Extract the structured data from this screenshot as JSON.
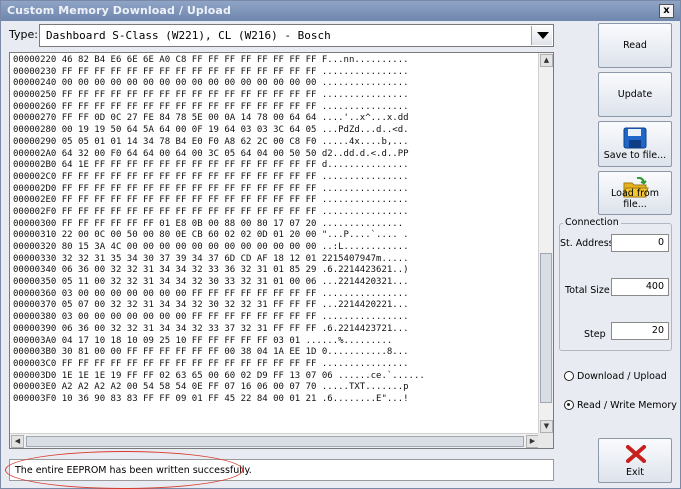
{
  "window": {
    "title": "Custom Memory Download / Upload",
    "close_label": "x"
  },
  "type_field": {
    "label": "Type:",
    "value": "Dashboard S-Class (W221), CL (W216) - Bosch"
  },
  "hex_lines": [
    "00000220 46 82 B4 E6 6E 6E A0 C8 FF FF FF FF FF FF FF FF F...nn..........",
    "00000230 FF FF FF FF FF FF FF FF FF FF FF FF FF FF FF FF ................",
    "00000240 00 00 00 00 00 00 00 00 00 00 00 00 00 00 00 00 ................",
    "00000250 FF FF FF FF FF FF FF FF FF FF FF FF FF FF FF FF ................",
    "00000260 FF FF FF FF FF FF FF FF FF FF FF FF FF FF FF FF ................",
    "00000270 FF FF 0D 0C 27 FE 84 78 5E 00 0A 14 78 00 64 64 ....'..x^...x.dd",
    "00000280 00 19 19 50 64 5A 64 00 0F 19 64 03 03 3C 64 05 ...PdZd...d..<d.",
    "00000290 05 05 01 01 14 34 78 B4 E0 F0 A8 62 2C 00 C8 F0 .....4x....b,...",
    "000002A0 64 32 00 F0 64 64 00 64 00 3C 05 64 04 00 50 50 d2..dd.d.<.d..PP",
    "000002B0 64 1E FF FF FF FF FF FF FF FF FF FF FF FF FF FF d...............",
    "000002C0 FF FF FF FF FF FF FF FF FF FF FF FF FF FF FF FF ................",
    "000002D0 FF FF FF FF FF FF FF FF FF FF FF FF FF FF FF FF ................",
    "000002E0 FF FF FF FF FF FF FF FF FF FF FF FF FF FF FF FF ................",
    "000002F0 FF FF FF FF FF FF FF FF FF FF FF FF FF FF FF FF ................",
    "00000300 FF FF FF FF FF FF 01 E8 0B 00 88 00 80 17 07 20 ...............",
    "00000310 22 00 0C 00 50 00 80 0E CB 60 02 02 0D 01 20 00 \"...P....`.... .",
    "00000320 80 15 3A 4C 00 00 00 00 00 00 00 00 00 00 00 00 ..:L............",
    "00000330 32 32 31 35 34 30 37 39 34 37 6D CD AF 18 12 01 2215407947m.....",
    "00000340 06 36 00 32 32 31 34 34 32 33 36 32 31 01 85 29 .6.2214423621..)",
    "00000350 05 11 00 32 32 31 34 34 32 30 33 32 31 01 00 06 ...2214420321...",
    "00000360 03 00 00 00 00 00 00 00 FF FF FF FF FF FF FF FF ................",
    "00000370 05 07 00 32 32 31 34 34 32 30 32 32 31 FF FF FF ...2214420221...",
    "00000380 03 00 00 00 00 00 00 00 FF FF FF FF FF FF FF FF ................",
    "00000390 06 36 00 32 32 31 34 34 32 33 37 32 31 FF FF FF .6.2214423721...",
    "000003A0 04 17 10 18 10 09 25 10 FF FF FF FF FF 03 01 ......%.........",
    "000003B0 30 81 00 00 FF FF FF FF FF FF 00 38 04 1A EE 1D 0...........8...",
    "000003C0 FF FF FF FF FF FF FF FF FF FF FF FF FF FF FF FF ................",
    "000003D0 1E 1E 1E 19 FF FF 02 63 65 00 60 02 D9 FF 13 07 06 ......ce.`......",
    "000003E0 A2 A2 A2 A2 00 54 58 54 0E FF 07 16 06 00 07 70 .....TXT.......p",
    "000003F0 10 36 90 83 83 FF FF 09 01 FF 45 22 84 00 01 21 .6........E\"...!"
  ],
  "status_text": "The entire EEPROM has been written successfully.",
  "buttons": {
    "read": "Read",
    "update": "Update",
    "save": "Save to file...",
    "load": "Load from file...",
    "exit": "Exit"
  },
  "connection": {
    "title": "Connection",
    "st_address_label": "St. Address",
    "st_address_value": "0",
    "total_size_label": "Total Size",
    "total_size_value": "400",
    "step_label": "Step",
    "step_value": "20"
  },
  "modes": {
    "download_upload": "Download / Upload",
    "read_write_memory": "Read / Write Memory",
    "selected": "Read / Write Memory"
  },
  "colors": {
    "titlebar": "#6f86ad",
    "highlight_circle": "#d93a2b",
    "exit_icon": "#c81e1e",
    "save_icon": "#1f66c8",
    "folder_icon": "#f2c531"
  }
}
